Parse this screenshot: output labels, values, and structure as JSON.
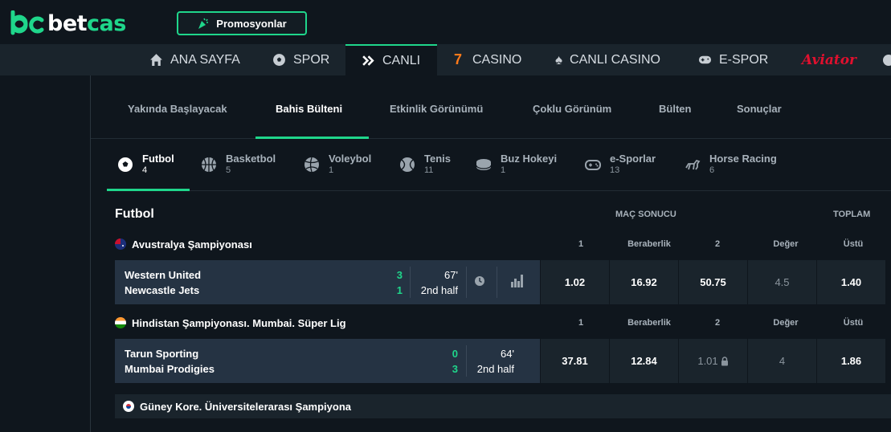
{
  "brand": {
    "logo_text_a": "bet",
    "logo_text_b": "cas"
  },
  "promo": {
    "label": "Promosyonlar"
  },
  "nav": [
    {
      "label": "ANA SAYFA",
      "icon": "home-icon"
    },
    {
      "label": "SPOR",
      "icon": "soccer-ball-icon"
    },
    {
      "label": "CANLI",
      "icon": "double-chevron-icon",
      "active": true
    },
    {
      "label": "CASINO",
      "icon": "seven-icon"
    },
    {
      "label": "CANLI CASINO",
      "icon": "spade-icon"
    },
    {
      "label": "E-SPOR",
      "icon": "gamepad-icon"
    },
    {
      "label": "Aviator",
      "icon": "aviator-logo"
    }
  ],
  "subtabs": [
    "Yakında Başlayacak",
    "Bahis Bülteni",
    "Etkinlik Görünümü",
    "Çoklu Görünüm",
    "Bülten",
    "Sonuçlar"
  ],
  "sports": [
    {
      "name": "Futbol",
      "count": "4",
      "icon": "soccer-ball-icon"
    },
    {
      "name": "Basketbol",
      "count": "5",
      "icon": "basketball-icon"
    },
    {
      "name": "Voleybol",
      "count": "1",
      "icon": "volleyball-icon"
    },
    {
      "name": "Tenis",
      "count": "11",
      "icon": "tennis-ball-icon"
    },
    {
      "name": "Buz Hokeyi",
      "count": "1",
      "icon": "hockey-puck-icon"
    },
    {
      "name": "e-Sporlar",
      "count": "13",
      "icon": "gamepad-icon"
    },
    {
      "name": "Horse Racing",
      "count": "6",
      "icon": "horse-icon"
    }
  ],
  "section": {
    "title": "Futbol",
    "market_result": "MAÇ SONUCU",
    "market_total": "TOPLAM"
  },
  "columns": {
    "c1": "1",
    "draw": "Beraberlik",
    "c2": "2",
    "value": "Değer",
    "over": "Üstü"
  },
  "leagues": [
    {
      "name": "Avustralya Şampiyonası",
      "flag": "australia",
      "match": {
        "home": "Western United",
        "away": "Newcastle Jets",
        "home_score": "3",
        "away_score": "1",
        "minute": "67'",
        "period": "2nd half",
        "odds": [
          "1.02",
          "16.92",
          "50.75",
          "4.5",
          "1.40"
        ]
      }
    },
    {
      "name": "Hindistan Şampiyonası. Mumbai. Süper Lig",
      "flag": "india",
      "match": {
        "home": "Tarun Sporting",
        "away": "Mumbai Prodigies",
        "home_score": "0",
        "away_score": "3",
        "minute": "64'",
        "period": "2nd half",
        "odds": [
          "37.81",
          "12.84",
          "1.01",
          "4",
          "1.86"
        ]
      }
    },
    {
      "name": "Güney Kore. Üniversitelerarası Şampiyona",
      "flag": "south-korea"
    }
  ],
  "colors": {
    "accent": "#1fd68b",
    "bg": "#0f161d",
    "panel": "#1a242c",
    "row": "#253343"
  }
}
